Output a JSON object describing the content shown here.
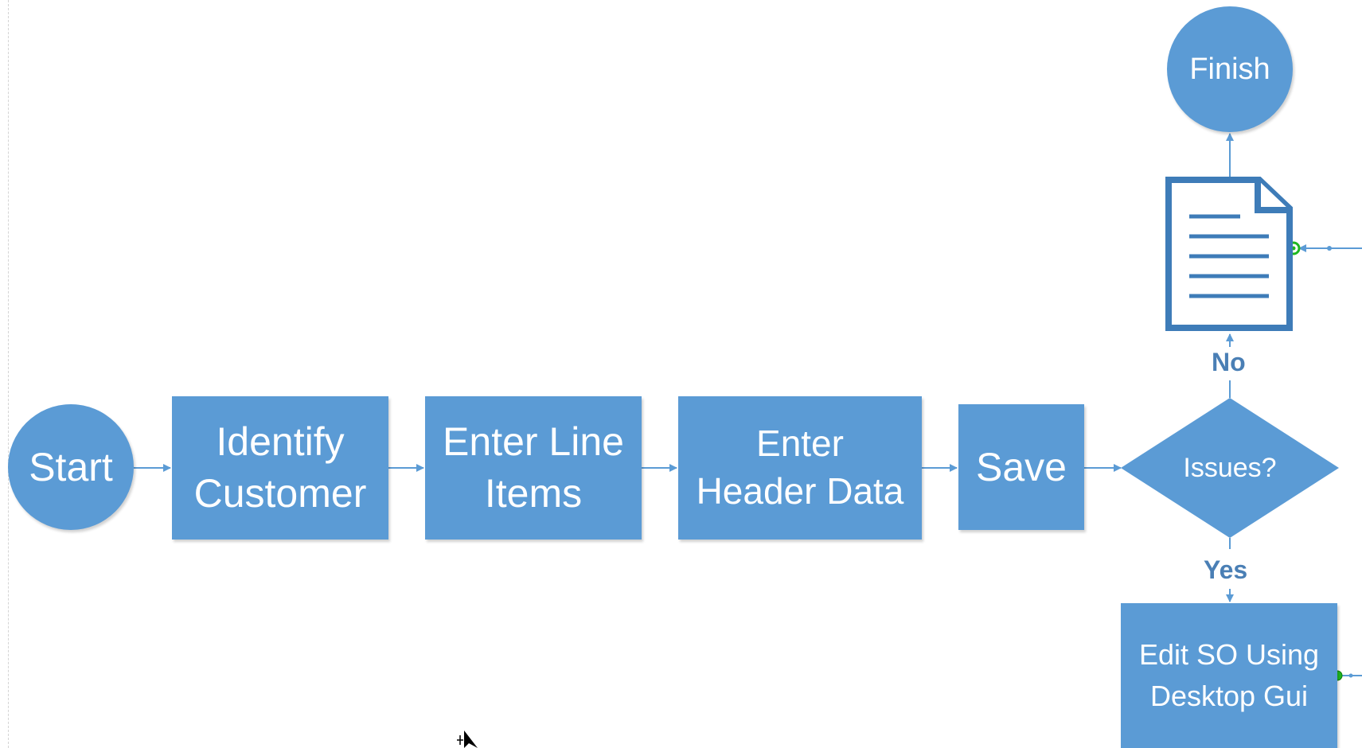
{
  "colors": {
    "shape_fill": "#5b9bd5",
    "connector": "#5b9bd5",
    "label_text": "#4a7fb5",
    "handle": "#1fb81f"
  },
  "nodes": {
    "start": "Start",
    "identify_customer": "Identify\nCustomer",
    "enter_line_items": "Enter Line\nItems",
    "enter_header_data": "Enter\nHeader Data",
    "save": "Save",
    "issues": "Issues?",
    "finish": "Finish",
    "edit_so": "Edit SO Using\nDesktop Gui"
  },
  "edge_labels": {
    "no": "No",
    "yes": "Yes"
  },
  "icons": {
    "document": "document-icon",
    "cursor": "mouse-cursor-icon"
  }
}
